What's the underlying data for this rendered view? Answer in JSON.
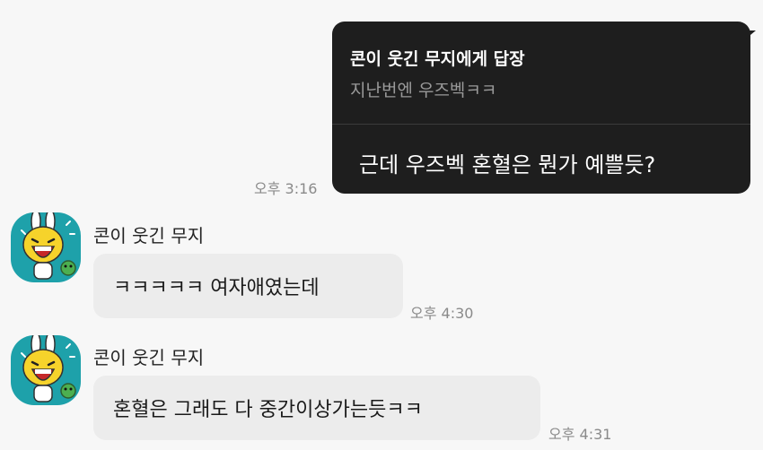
{
  "messages": [
    {
      "reply_title": "콘이 웃긴 무지에게 답장",
      "reply_quote": "지난번엔 우즈벡ㅋㅋ",
      "text": "근데 우즈벡 혼혈은 뭔가 예쁠듯?",
      "time": "오후 3:16"
    },
    {
      "sender": "콘이 웃긴 무지",
      "text": "ㅋㅋㅋㅋㅋ 여자애였는데",
      "time": "오후 4:30",
      "avatar_icon": "muzi-laughing-avatar-icon"
    },
    {
      "sender": "콘이 웃긴 무지",
      "text": "혼혈은 그래도 다 중간이상가는듯ㅋㅋ",
      "time": "오후 4:31",
      "avatar_icon": "muzi-laughing-avatar-icon"
    }
  ],
  "colors": {
    "background": "#f7f7f7",
    "my_bubble": "#1e1e1e",
    "their_bubble": "#ececec",
    "avatar_bg": "#1ea1aa"
  }
}
